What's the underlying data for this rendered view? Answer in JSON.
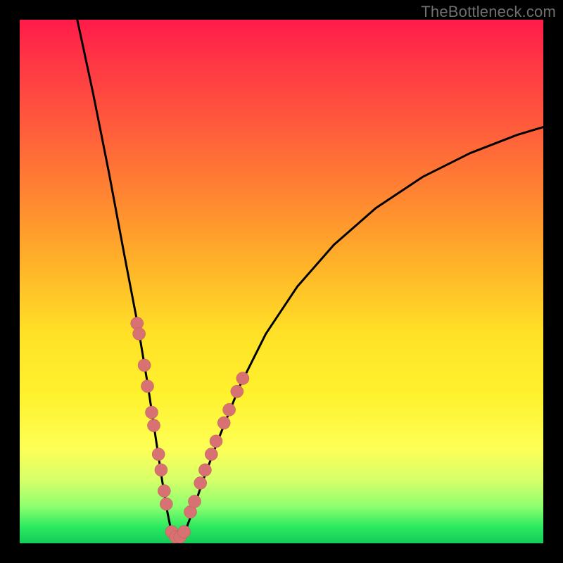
{
  "watermark": "TheBottleneck.com",
  "chart_data": {
    "type": "line",
    "title": "",
    "xlabel": "",
    "ylabel": "",
    "xlim": [
      0,
      100
    ],
    "ylim": [
      0,
      100
    ],
    "background_gradient": {
      "top": "#ff1b4a",
      "upper_mid": "#ffb728",
      "lower_mid": "#fff22e",
      "bottom": "#14cc58"
    },
    "series": [
      {
        "name": "bottleneck-curve",
        "color": "#000000",
        "x": [
          11,
          14,
          17,
          20,
          22.5,
          24.5,
          26,
          27.2,
          28.2,
          29,
          29.7,
          30.5,
          31.5,
          33,
          35,
          38,
          42,
          47,
          53,
          60,
          68,
          77,
          86,
          95,
          100
        ],
        "y": [
          100,
          86,
          71,
          55,
          42,
          30,
          20,
          12,
          6,
          2,
          0.5,
          0.5,
          2,
          6,
          12,
          20,
          30,
          40,
          49,
          57,
          64,
          70,
          74.5,
          78,
          79.5
        ]
      }
    ],
    "marker_clusters": [
      {
        "name": "left-branch-dots",
        "color": "#d87272",
        "points": [
          {
            "x": 22.4,
            "y": 42
          },
          {
            "x": 22.8,
            "y": 40
          },
          {
            "x": 23.8,
            "y": 34
          },
          {
            "x": 24.4,
            "y": 30
          },
          {
            "x": 25.2,
            "y": 25
          },
          {
            "x": 25.6,
            "y": 22.5
          },
          {
            "x": 26.5,
            "y": 17
          },
          {
            "x": 27.0,
            "y": 14
          },
          {
            "x": 27.6,
            "y": 10
          },
          {
            "x": 28.0,
            "y": 7.5
          }
        ]
      },
      {
        "name": "bottom-dots",
        "color": "#d87272",
        "points": [
          {
            "x": 29.0,
            "y": 2.2
          },
          {
            "x": 29.8,
            "y": 1.2
          },
          {
            "x": 30.6,
            "y": 1.2
          },
          {
            "x": 31.4,
            "y": 2.2
          }
        ]
      },
      {
        "name": "right-branch-dots",
        "color": "#d87272",
        "points": [
          {
            "x": 32.6,
            "y": 6
          },
          {
            "x": 33.4,
            "y": 8
          },
          {
            "x": 34.5,
            "y": 11.5
          },
          {
            "x": 35.4,
            "y": 14
          },
          {
            "x": 36.6,
            "y": 17
          },
          {
            "x": 37.5,
            "y": 19.5
          },
          {
            "x": 39.0,
            "y": 23
          },
          {
            "x": 40.0,
            "y": 25.5
          },
          {
            "x": 41.5,
            "y": 29
          },
          {
            "x": 42.6,
            "y": 31.5
          }
        ]
      }
    ]
  }
}
